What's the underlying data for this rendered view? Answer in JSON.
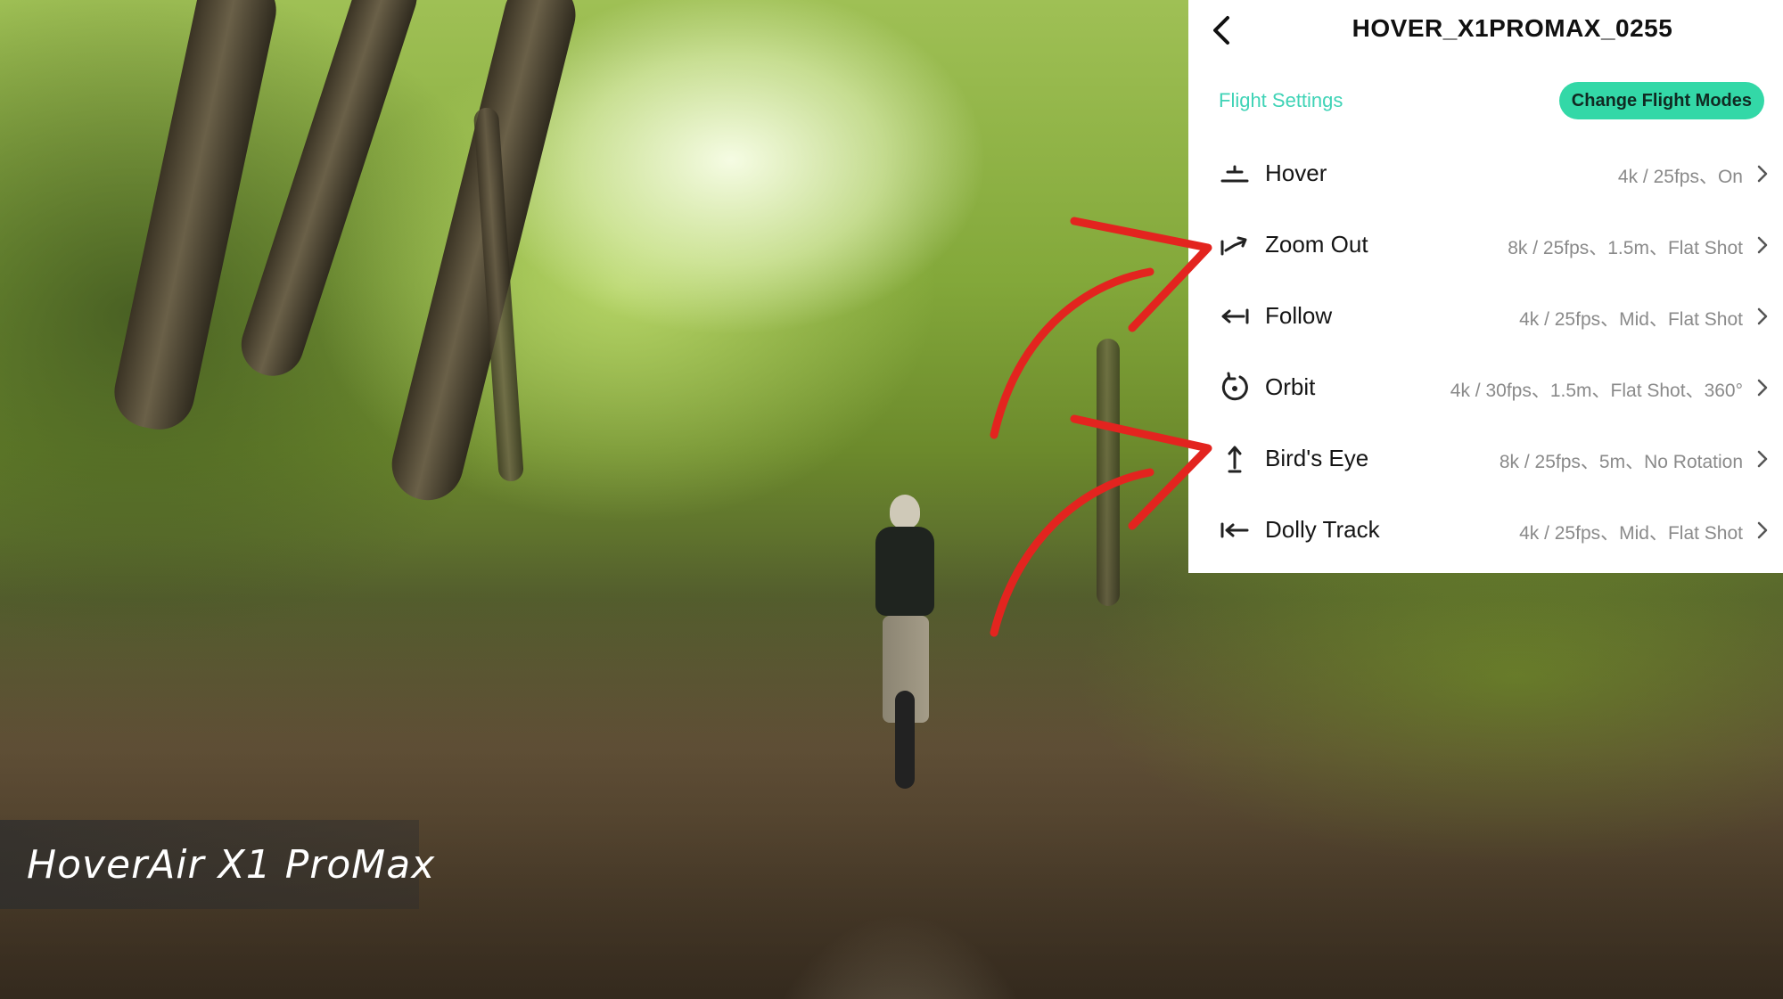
{
  "header": {
    "title": "HOVER_X1PROMAX_0255",
    "back_icon": "chevron-left-icon"
  },
  "toolbar": {
    "flight_settings_label": "Flight Settings",
    "change_modes_label": "Change Flight Modes"
  },
  "modes": [
    {
      "name": "Hover",
      "detail": "4k / 25fps、On",
      "icon": "hover-icon"
    },
    {
      "name": "Zoom Out",
      "detail": "8k / 25fps、1.5m、Flat Shot",
      "icon": "zoom-out-icon"
    },
    {
      "name": "Follow",
      "detail": "4k / 25fps、Mid、Flat Shot",
      "icon": "follow-icon"
    },
    {
      "name": "Orbit",
      "detail": "4k / 30fps、1.5m、Flat Shot、360°",
      "icon": "orbit-icon"
    },
    {
      "name": "Bird's Eye",
      "detail": "8k / 25fps、5m、No Rotation",
      "icon": "birds-eye-icon"
    },
    {
      "name": "Dolly Track",
      "detail": "4k / 25fps、Mid、Flat Shot",
      "icon": "dolly-track-icon"
    }
  ],
  "caption": {
    "text": "HoverAir X1 ProMax"
  },
  "colors": {
    "accent": "#33d8a7",
    "accent_text": "#3fd3b6",
    "annotation": "#e3241f",
    "panel_bg": "#ffffff"
  }
}
